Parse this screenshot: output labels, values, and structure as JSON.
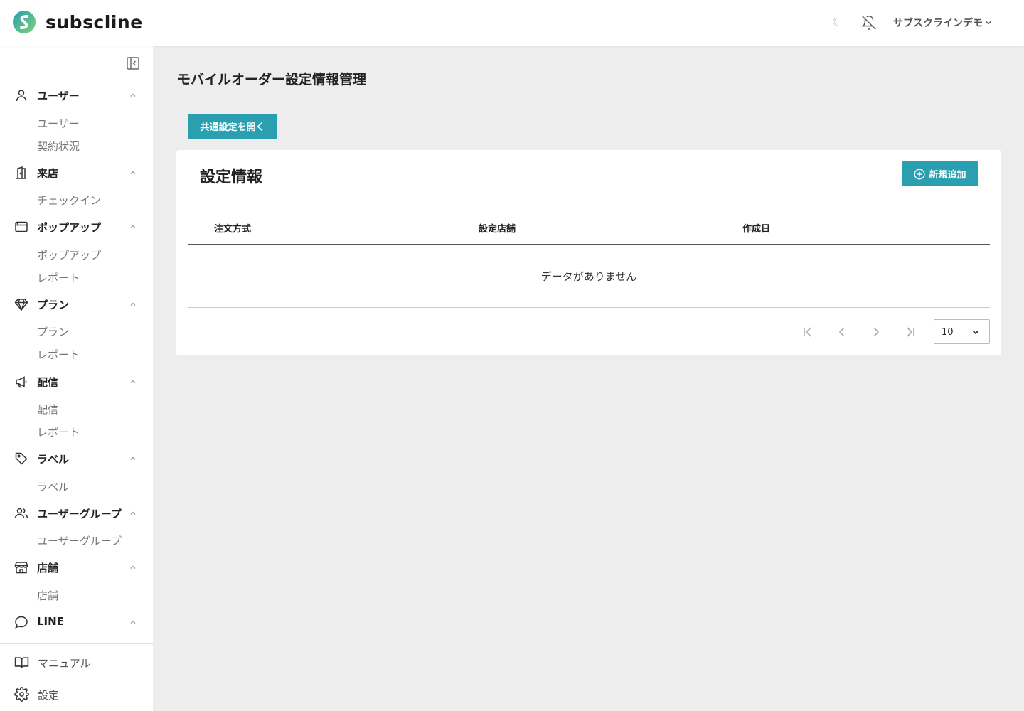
{
  "header": {
    "brand": "subscline",
    "user_name": "サブスクラインデモ",
    "icons": {
      "theme": "moon-icon",
      "notifications": "bell-off-icon",
      "dropdown": "chevron-down-icon"
    }
  },
  "sidebar": {
    "sections": [
      {
        "label": "ユーザー",
        "icon": "user-icon",
        "items": [
          "ユーザー",
          "契約状況"
        ]
      },
      {
        "label": "来店",
        "icon": "store-entrance-icon",
        "items": [
          "チェックイン"
        ]
      },
      {
        "label": "ポップアップ",
        "icon": "window-icon",
        "items": [
          "ポップアップ",
          "レポート"
        ]
      },
      {
        "label": "プラン",
        "icon": "diamond-icon",
        "items": [
          "プラン",
          "レポート"
        ]
      },
      {
        "label": "配信",
        "icon": "megaphone-icon",
        "items": [
          "配信",
          "レポート"
        ]
      },
      {
        "label": "ラベル",
        "icon": "tag-icon",
        "items": [
          "ラベル"
        ]
      },
      {
        "label": "ユーザーグループ",
        "icon": "users-icon",
        "items": [
          "ユーザーグループ"
        ]
      },
      {
        "label": "店舗",
        "icon": "shop-icon",
        "items": [
          "店舗"
        ]
      },
      {
        "label": "LINE",
        "icon": "chat-bubble-icon",
        "items": []
      }
    ],
    "bottom": [
      {
        "label": "マニュアル",
        "icon": "book-icon"
      },
      {
        "label": "設定",
        "icon": "gear-icon"
      }
    ]
  },
  "main": {
    "title": "モバイルオーダー設定情報管理",
    "common_button": "共通設定を開く",
    "card": {
      "title": "設定情報",
      "add_button": "新規追加",
      "columns": [
        "注文方式",
        "設定店舗",
        "作成日"
      ],
      "empty_message": "データがありません",
      "page_size": "10"
    }
  },
  "colors": {
    "accent": "#2a9fb0",
    "background": "#ededed"
  }
}
